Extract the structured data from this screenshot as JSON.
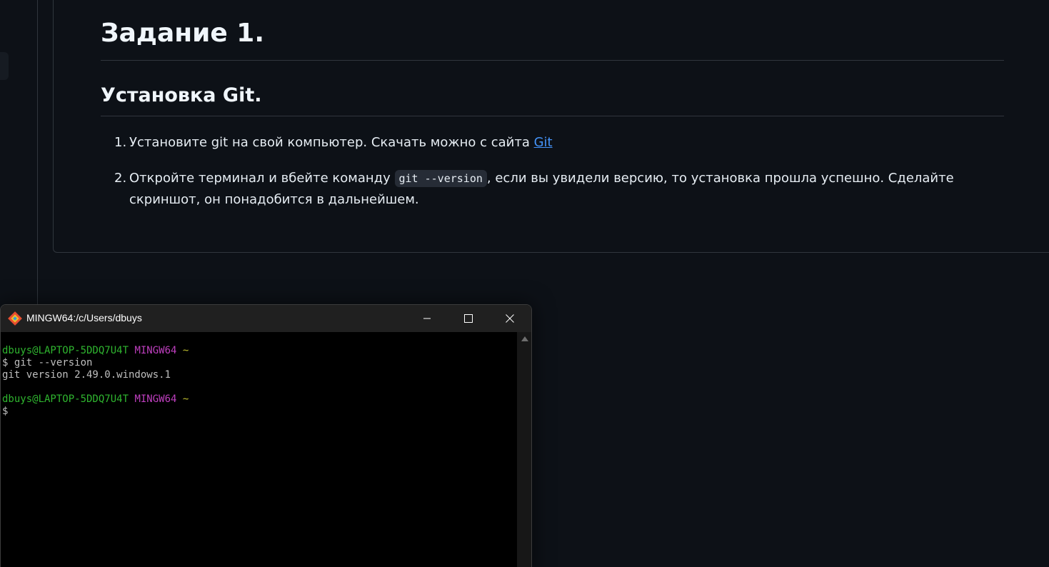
{
  "doc": {
    "heading1": "Задание 1.",
    "heading2": "Установка Git.",
    "step1": {
      "num": "1.",
      "text": "Установите git на свой компьютер. Скачать можно с сайта ",
      "link": "Git"
    },
    "step2": {
      "num": "2.",
      "text_before": "Откройте терминал и вбейте команду ",
      "code": "git --version",
      "text_after": ", если вы увидели версию, то установка прошла успешно. Сделайте скриншот, он понадобится в дальнейшем."
    }
  },
  "terminal": {
    "title": "MINGW64:/c/Users/dbuys",
    "app_icon": "git-icon",
    "lines": [
      {
        "user": "dbuys@LAPTOP-5DDQ7U4T",
        "env": "MINGW64",
        "path": "~"
      },
      {
        "cmd": "$ git --version"
      },
      {
        "out": "git version 2.49.0.windows.1"
      },
      {
        "user": "dbuys@LAPTOP-5DDQ7U4T",
        "env": "MINGW64",
        "path": "~"
      },
      {
        "cmd": "$"
      }
    ]
  }
}
